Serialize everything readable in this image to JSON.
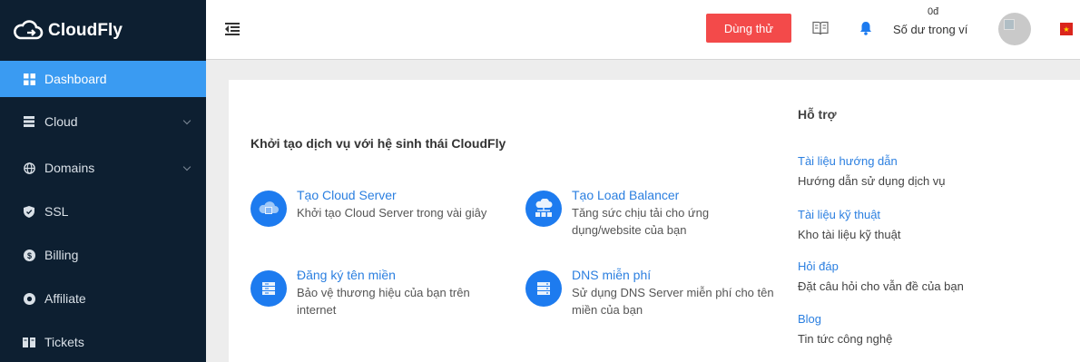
{
  "brand": {
    "name": "CloudFly",
    "accent": "#3a9bf2",
    "danger": "#f34a4a",
    "sidebar_bg": "#0d1f31"
  },
  "sidebar": {
    "items": [
      {
        "label": "Dashboard",
        "icon": "grid-icon",
        "active": true
      },
      {
        "label": "Cloud",
        "icon": "server-icon",
        "has_submenu": true
      },
      {
        "label": "Domains",
        "icon": "globe-icon",
        "has_submenu": true
      },
      {
        "label": "SSL",
        "icon": "shield-icon"
      },
      {
        "label": "Billing",
        "icon": "dollar-icon"
      },
      {
        "label": "Affiliate",
        "icon": "affiliate-icon"
      },
      {
        "label": "Tickets",
        "icon": "ticket-icon"
      }
    ]
  },
  "header": {
    "trial_label": "Dùng thử",
    "balance_amount": "0đ",
    "balance_label": "Số dư trong ví"
  },
  "main": {
    "title": "Khởi tạo dịch vụ với hệ sinh thái CloudFly",
    "services": [
      {
        "title": "Tạo Cloud Server",
        "desc": "Khởi tạo Cloud Server trong vài giây",
        "icon": "cloud-server-icon"
      },
      {
        "title": "Tạo Load Balancer",
        "desc": "Tăng sức chịu tải cho ứng dụng/website của bạn",
        "icon": "load-balancer-icon"
      },
      {
        "title": "Đăng ký tên miền",
        "desc": "Bảo vệ thương hiệu của bạn trên internet",
        "icon": "domain-icon"
      },
      {
        "title": "DNS miễn phí",
        "desc": "Sử dụng DNS Server miễn phí cho tên miền của bạn",
        "icon": "dns-icon"
      }
    ]
  },
  "support": {
    "title": "Hỗ trợ",
    "items": [
      {
        "title": "Tài liệu hướng dẫn",
        "desc": "Hướng dẫn sử dụng dịch vụ"
      },
      {
        "title": "Tài liệu kỹ thuật",
        "desc": "Kho tài liệu kỹ thuật"
      },
      {
        "title": "Hỏi đáp",
        "desc": "Đặt câu hỏi cho vẫn đề của bạn"
      },
      {
        "title": "Blog",
        "desc": "Tin tức công nghệ"
      }
    ]
  }
}
